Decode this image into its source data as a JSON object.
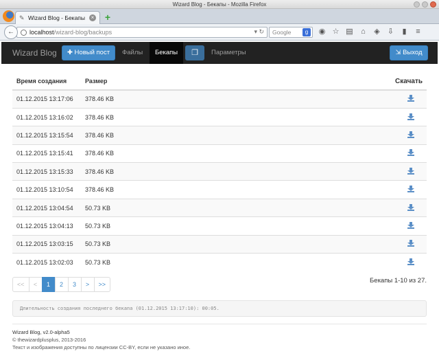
{
  "window": {
    "title": "Wizard Blog - Бекапы - Mozilla Firefox"
  },
  "browser": {
    "tab_title": "Wizard Blog - Бекапы",
    "url_host": "localhost",
    "url_path": "/wizard-blog/backups",
    "search_placeholder": "Google"
  },
  "navbar": {
    "brand": "Wizard Blog",
    "new_post": "Новый пост",
    "files": "Файлы",
    "backups": "Бекапы",
    "settings": "Параметры",
    "logout": "Выход"
  },
  "table": {
    "headers": {
      "created": "Время создания",
      "size": "Размер",
      "download": "Скачать"
    },
    "rows": [
      {
        "time": "01.12.2015 13:17:06",
        "size": "378.46 KB"
      },
      {
        "time": "01.12.2015 13:16:02",
        "size": "378.46 KB"
      },
      {
        "time": "01.12.2015 13:15:54",
        "size": "378.46 KB"
      },
      {
        "time": "01.12.2015 13:15:41",
        "size": "378.46 KB"
      },
      {
        "time": "01.12.2015 13:15:33",
        "size": "378.46 KB"
      },
      {
        "time": "01.12.2015 13:10:54",
        "size": "378.46 KB"
      },
      {
        "time": "01.12.2015 13:04:54",
        "size": "50.73 KB"
      },
      {
        "time": "01.12.2015 13:04:13",
        "size": "50.73 KB"
      },
      {
        "time": "01.12.2015 13:03:15",
        "size": "50.73 KB"
      },
      {
        "time": "01.12.2015 13:02:03",
        "size": "50.73 KB"
      }
    ]
  },
  "pagination": {
    "first": "<<",
    "prev": "<",
    "p1": "1",
    "p2": "2",
    "p3": "3",
    "next": ">",
    "last": ">>",
    "counter": "Бекапы 1-10 из 27."
  },
  "info": {
    "duration": "Длительность создания последнего бекапа (01.12.2015 13:17:10): 00:05."
  },
  "footer": {
    "version": "Wizard Blog, v2.0-alpha5",
    "copyright": "© thewizardplusplus, 2013-2016",
    "license": "Текст и изображения доступны по лицензии CC-BY, если не указано иное."
  },
  "colors": {
    "primary": "#428bca",
    "navbar": "#222222"
  }
}
